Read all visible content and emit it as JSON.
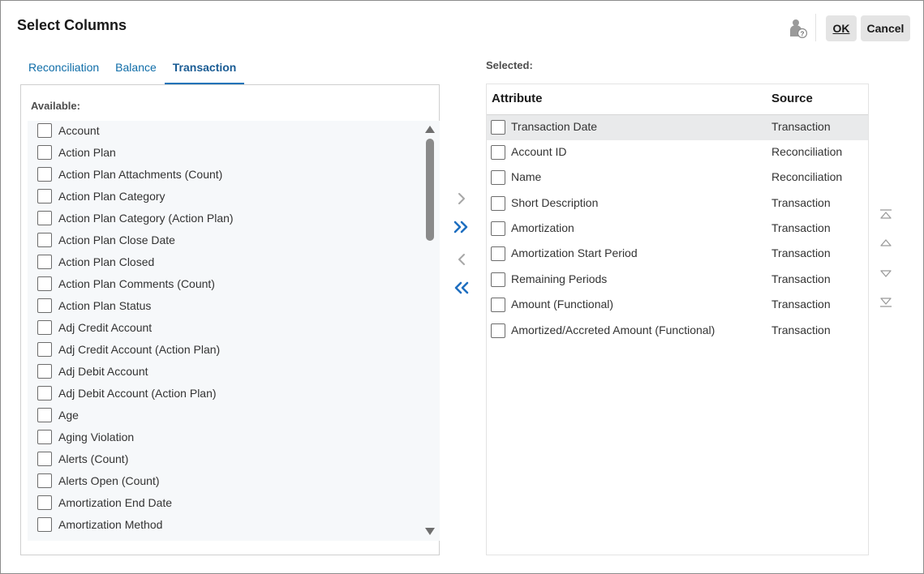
{
  "dialog": {
    "title": "Select Columns",
    "ok_label": "OK",
    "cancel_label": "Cancel",
    "help_icon": "user-help-icon"
  },
  "tabs": [
    {
      "label": "Reconciliation",
      "active": false
    },
    {
      "label": "Balance",
      "active": false
    },
    {
      "label": "Transaction",
      "active": true
    }
  ],
  "available": {
    "label": "Available:",
    "items": [
      "Account",
      "Action Plan",
      "Action Plan Attachments (Count)",
      "Action Plan Category",
      "Action Plan Category (Action Plan)",
      "Action Plan Close Date",
      "Action Plan Closed",
      "Action Plan Comments (Count)",
      "Action Plan Status",
      "Adj Credit Account",
      "Adj Credit Account (Action Plan)",
      "Adj Debit Account",
      "Adj Debit Account (Action Plan)",
      "Age",
      "Aging Violation",
      "Alerts (Count)",
      "Alerts Open (Count)",
      "Amortization End Date",
      "Amortization Method"
    ]
  },
  "movers": {
    "move_right_icon": "chevron-right-icon",
    "move_all_right_icon": "double-chevron-right-icon",
    "move_left_icon": "chevron-left-icon",
    "move_all_left_icon": "double-chevron-left-icon"
  },
  "selected": {
    "label": "Selected:",
    "columns": {
      "attribute": "Attribute",
      "source": "Source"
    },
    "rows": [
      {
        "attribute": "Transaction Date",
        "source": "Transaction"
      },
      {
        "attribute": "Account ID",
        "source": "Reconciliation"
      },
      {
        "attribute": "Name",
        "source": "Reconciliation"
      },
      {
        "attribute": "Short Description",
        "source": "Transaction"
      },
      {
        "attribute": "Amortization",
        "source": "Transaction"
      },
      {
        "attribute": "Amortization Start Period",
        "source": "Transaction"
      },
      {
        "attribute": "Remaining Periods",
        "source": "Transaction"
      },
      {
        "attribute": "Amount (Functional)",
        "source": "Transaction"
      },
      {
        "attribute": "Amortized/Accreted Amount (Functional)",
        "source": "Transaction"
      }
    ]
  },
  "colors": {
    "accent": "#1973b8",
    "tab_text": "#0f6da8",
    "mover_active": "#1f6fc0",
    "mover_disabled": "#a6a6a6",
    "row_highlight": "#e9eaeb"
  }
}
